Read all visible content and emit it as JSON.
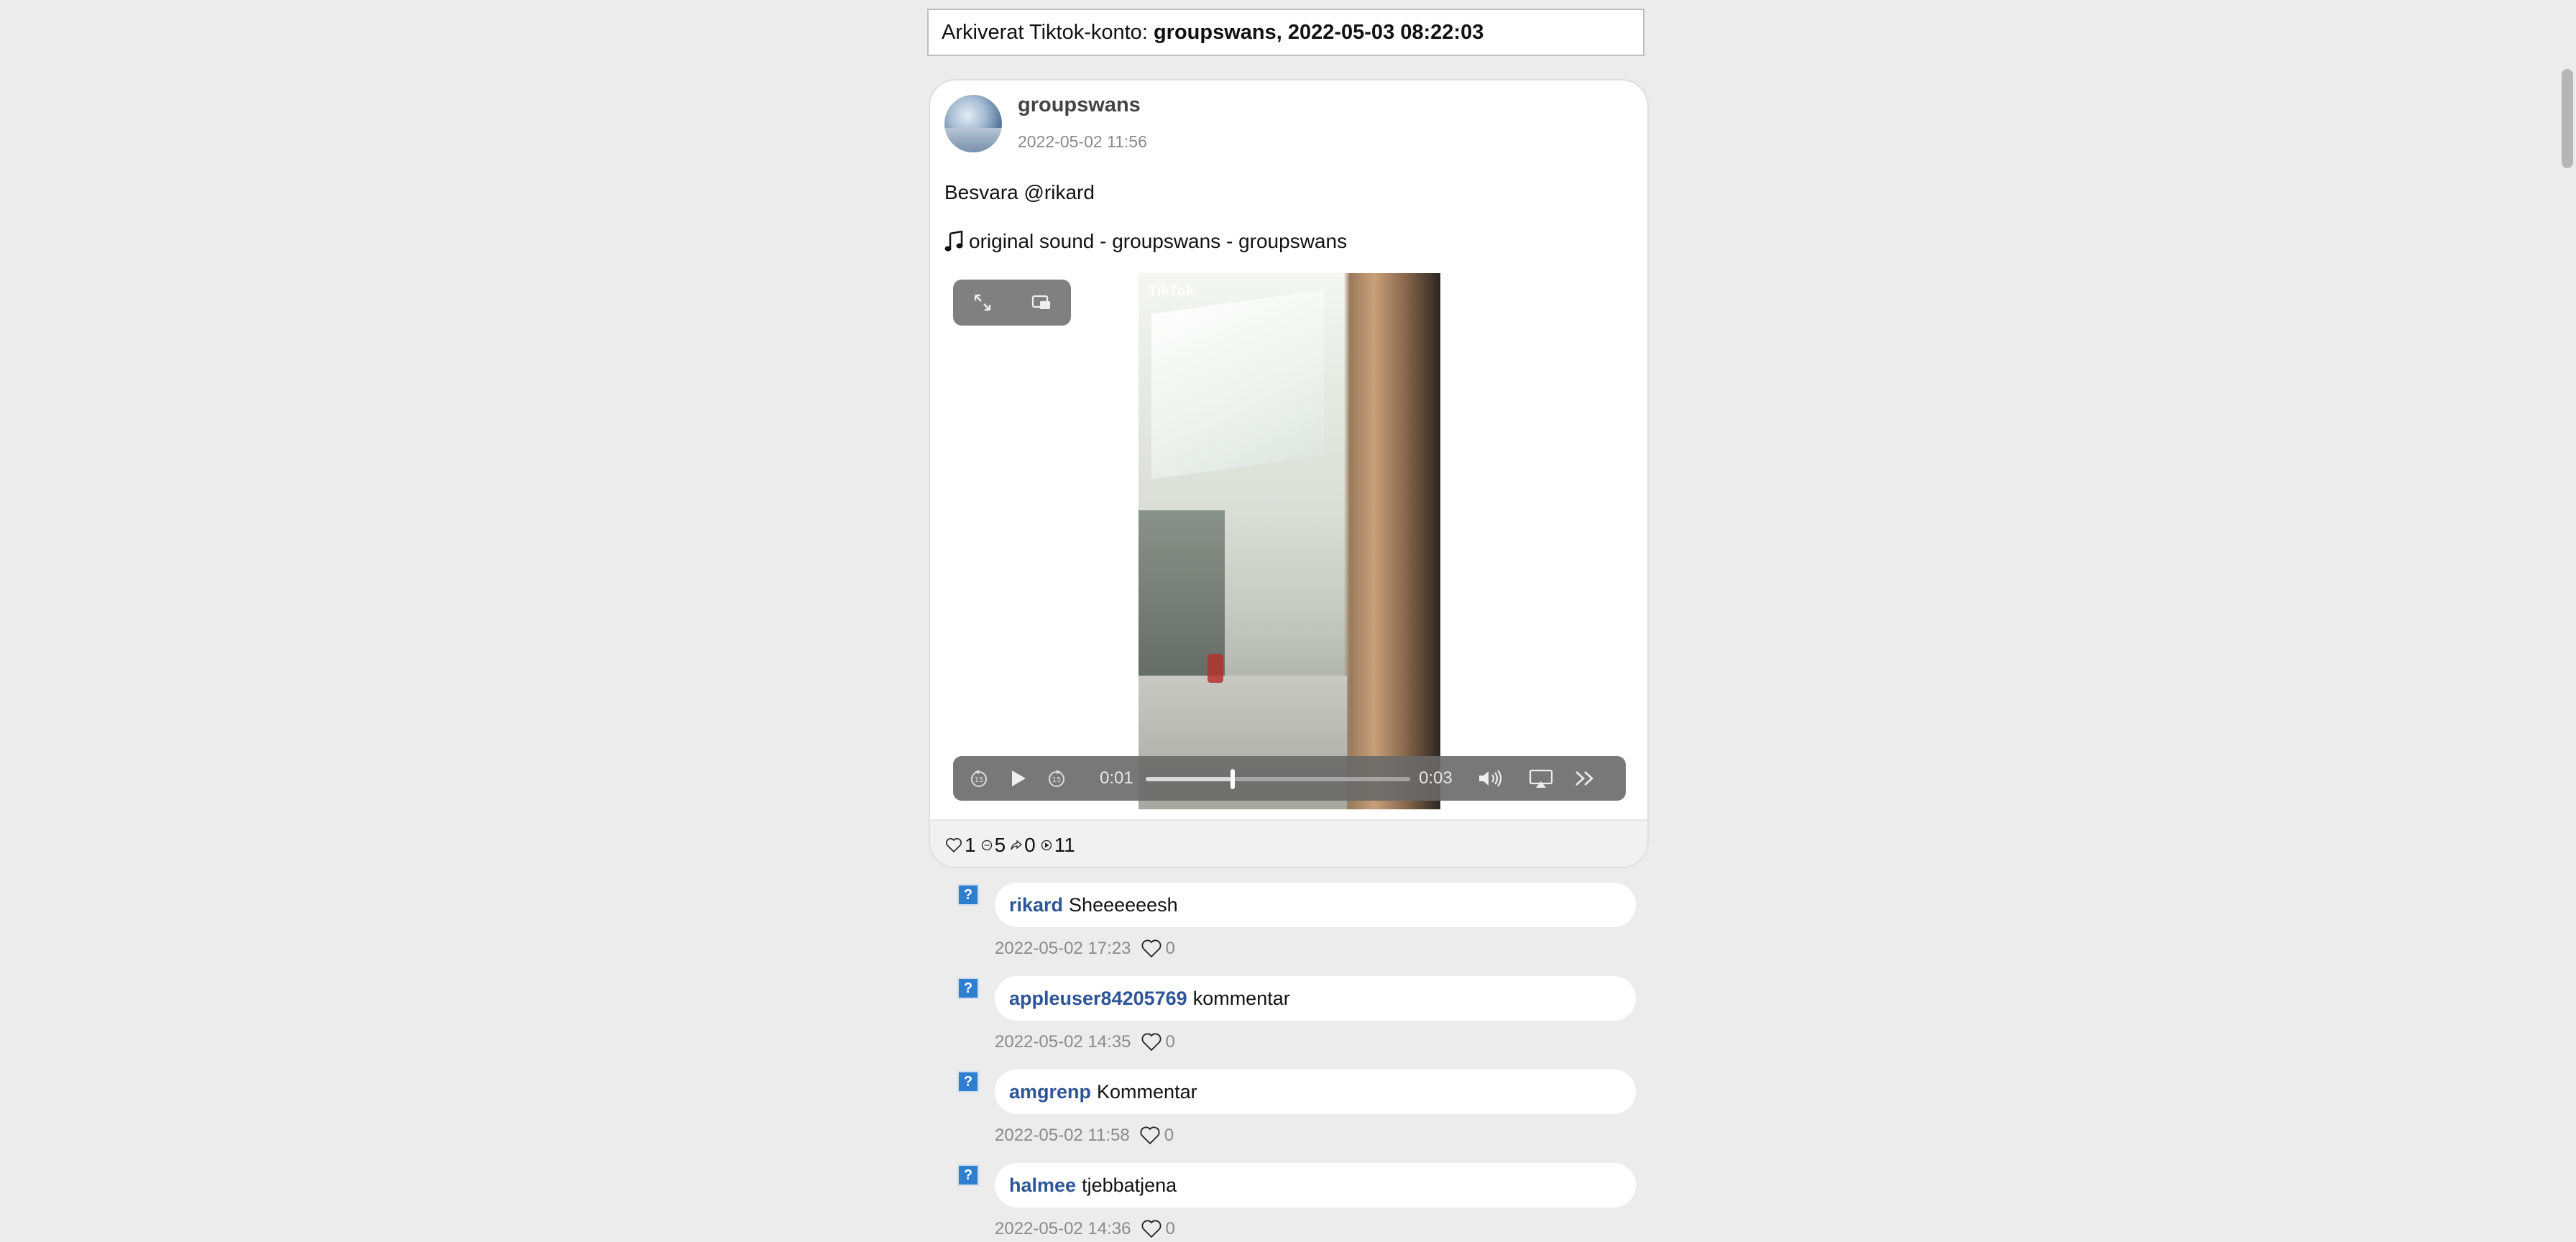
{
  "header": {
    "label": "Arkiverat Tiktok-konto:",
    "account_and_date": "groupswans, 2022-05-03 08:22:03"
  },
  "post": {
    "author": "groupswans",
    "date": "2022-05-02 11:56",
    "caption": "Besvara @rikard",
    "music_icon": "music-note-icon",
    "music": "original sound - groupswans - groupswans",
    "video_watermark": "TikTok",
    "player": {
      "current_time": "0:01",
      "duration": "0:03",
      "progress_fraction": 0.33
    },
    "stats": {
      "likes": "1",
      "comments": "5",
      "shares": "0",
      "plays": "11"
    }
  },
  "comments": [
    {
      "user": "rikard",
      "text": "Sheeeeeesh",
      "date": "2022-05-02 17:23",
      "likes": "0"
    },
    {
      "user": "appleuser84205769",
      "text": "kommentar",
      "date": "2022-05-02 14:35",
      "likes": "0"
    },
    {
      "user": "amgrenp",
      "text": "Kommentar",
      "date": "2022-05-02 11:58",
      "likes": "0"
    },
    {
      "user": "halmee",
      "text": "tjebbatjena",
      "date": "2022-05-02 14:36",
      "likes": "0"
    }
  ],
  "comment_avatar_glyph": "?",
  "colors": {
    "username_link": "#2d5597",
    "page_background": "#ececec"
  }
}
